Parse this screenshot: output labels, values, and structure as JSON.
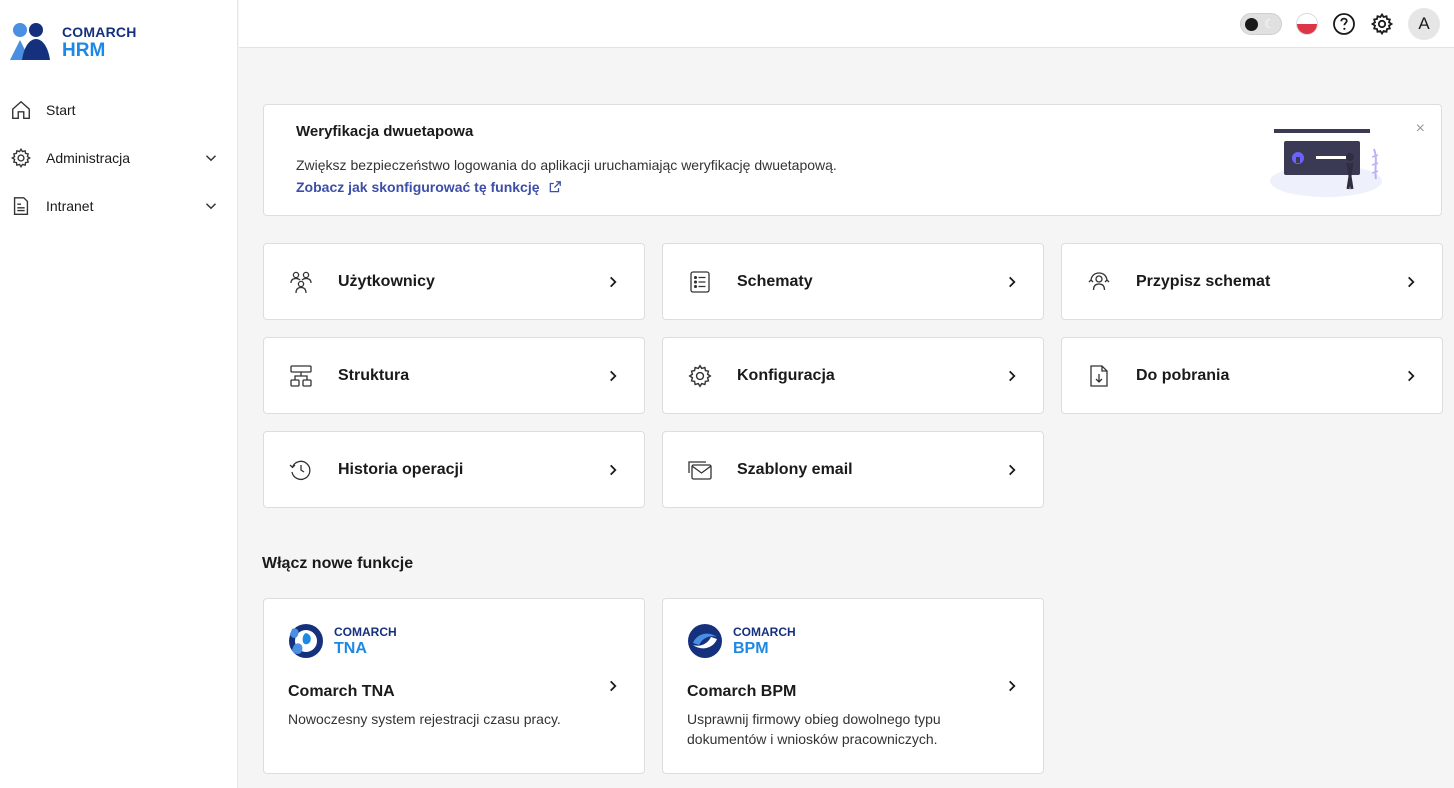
{
  "brand": {
    "company": "COMARCH",
    "product": "HRM"
  },
  "sidebar": {
    "items": [
      {
        "label": "Start",
        "icon": "home-icon"
      },
      {
        "label": "Administracja",
        "icon": "gear-icon",
        "expandable": true
      },
      {
        "label": "Intranet",
        "icon": "document-icon",
        "expandable": true
      }
    ]
  },
  "topbar": {
    "theme_toggle": "dark-mode-toggle",
    "language": "PL",
    "avatar_initial": "A"
  },
  "banner": {
    "title": "Weryfikacja dwuetapowa",
    "description": "Zwiększ bezpieczeństwo logowania do aplikacji uruchamiając weryfikację dwuetapową.",
    "link": "Zobacz jak skonfigurować tę funkcję",
    "close": "×"
  },
  "tiles": [
    {
      "label": "Użytkownicy",
      "icon": "users-icon"
    },
    {
      "label": "Schematy",
      "icon": "list-icon"
    },
    {
      "label": "Przypisz schemat",
      "icon": "assign-user-icon"
    },
    {
      "label": "Struktura",
      "icon": "hierarchy-icon"
    },
    {
      "label": "Konfiguracja",
      "icon": "gear-icon"
    },
    {
      "label": "Do pobrania",
      "icon": "download-file-icon"
    },
    {
      "label": "Historia operacji",
      "icon": "history-icon"
    },
    {
      "label": "Szablony email",
      "icon": "email-icon"
    }
  ],
  "section": {
    "title": "Włącz nowe funkcje"
  },
  "features": [
    {
      "brand": "COMARCH",
      "product": "TNA",
      "title": "Comarch TNA",
      "description": "Nowoczesny system rejestracji czasu pracy."
    },
    {
      "brand": "COMARCH",
      "product": "BPM",
      "title": "Comarch BPM",
      "description": "Usprawnij firmowy obieg dowolnego typu dokumentów i wniosków pracowniczych."
    }
  ],
  "colors": {
    "brand_dark": "#15317e",
    "brand_blue": "#1e88e5",
    "link": "#3d4ea8",
    "background": "#f5f5f5"
  }
}
